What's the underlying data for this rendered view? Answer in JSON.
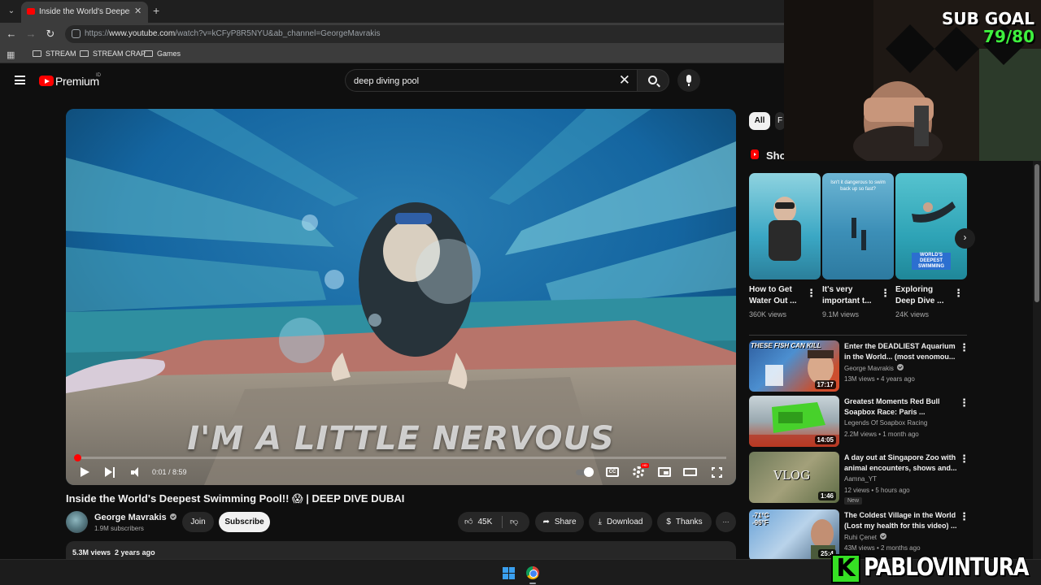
{
  "browser": {
    "tab_title": "Inside the World's Deepest Swin",
    "url_prefix": "https://",
    "url_host": "www.youtube.com",
    "url_path": "/watch?v=kCFyP8R5NYU&ab_channel=GeorgeMavrakis",
    "bookmarks": [
      "STREAM",
      "STREAM CRAP",
      "Games"
    ]
  },
  "youtube": {
    "logo_text": "Premium",
    "country_code": "ID",
    "search_query": "deep diving pool"
  },
  "player": {
    "subtitle": "I'M A LITTLE NERVOUS",
    "time_current": "0:01",
    "time_separator": " / ",
    "time_total": "8:59",
    "progress_fraction": 0.002,
    "cc_label": "CC",
    "hd_label": "HD"
  },
  "video": {
    "title": "Inside the World's Deepest Swimming Pool!! 😱 | DEEP DIVE DUBAI",
    "channel_name": "George Mavrakis",
    "subscribers": "1.9M subscribers",
    "join_label": "Join",
    "subscribe_label": "Subscribe",
    "likes": "45K",
    "share_label": "Share",
    "download_label": "Download",
    "thanks_label": "Thanks",
    "more_label": "···",
    "views": "5.3M views",
    "age": "2 years ago"
  },
  "sidebar": {
    "chips": [
      "All",
      "F"
    ],
    "shorts_heading": "Sho",
    "shorts": [
      {
        "title_line1": "How to Get",
        "title_line2": "Water Out ...",
        "views": "360K views",
        "thumb_text": ""
      },
      {
        "title_line1": "It's very",
        "title_line2": "important t...",
        "views": "9.1M views",
        "thumb_text": "Isn't it dangerous to swim back up so fast?"
      },
      {
        "title_line1": "Exploring",
        "title_line2": "Deep Dive ...",
        "views": "24K views",
        "thumb_text": "WORLD'S DEEPEST SWIMMING"
      }
    ],
    "recommendations": [
      {
        "title_line1": "Enter the DEADLIEST Aquarium",
        "title_line2": "in the World... (most venomou...",
        "channel": "George Mavrakis",
        "meta": "13M views • 4 years ago",
        "duration": "17:17",
        "thumb_text": "THESE FISH CAN KILL",
        "badge": ""
      },
      {
        "title_line1": "Greatest Moments Red Bull",
        "title_line2": "Soapbox Race: Paris ...",
        "channel": "Legends Of Soapbox Racing",
        "meta": "2.2M views • 1 month ago",
        "duration": "14:05",
        "thumb_text": "",
        "badge": ""
      },
      {
        "title_line1": "A day out at Singapore Zoo with",
        "title_line2": "animal encounters, shows and...",
        "channel": "Aamna_YT",
        "meta": "12 views • 5 hours ago",
        "duration": "1:46",
        "thumb_text": "VLOG",
        "badge": "New"
      },
      {
        "title_line1": "The Coldest Village in the World",
        "title_line2": "(Lost my health for this video) ...",
        "channel": "Ruhi Çenet",
        "meta": "43M views • 2 months ago",
        "duration": "25:4",
        "thumb_text": "-71°C -96°F",
        "badge": ""
      }
    ]
  },
  "overlay": {
    "sub_goal_label": "SUB GOAL",
    "sub_goal_value": "79/80",
    "brand_letter": "K",
    "brand_name": "PABLOVINTURA"
  },
  "colors": {
    "background": "#0f0f0f",
    "accent_red": "#ff0000",
    "sub_goal_green": "#3ef03e",
    "brand_green": "#36e024"
  },
  "icons": [
    "search-icon",
    "mic-icon",
    "close-icon",
    "hamburger-icon",
    "play-icon",
    "next-icon",
    "volume-icon",
    "settings-icon",
    "like-icon",
    "dislike-icon",
    "share-icon",
    "download-icon",
    "thanks-icon",
    "chevron-right-icon",
    "windows-icon",
    "chrome-icon"
  ]
}
